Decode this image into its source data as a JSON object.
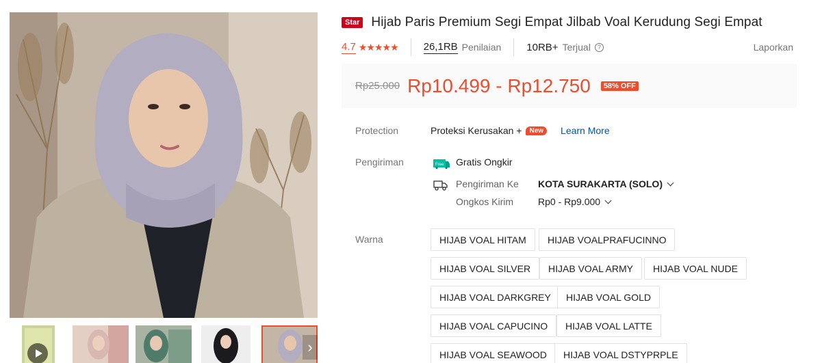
{
  "product": {
    "badge": "Star",
    "title": "Hijab Paris Premium Segi Empat Jilbab Voal Kerudung Segi Empat"
  },
  "rating": {
    "score": "4.7",
    "stars": "★★★★★",
    "reviews_count": "26,1RB",
    "reviews_label": "Penilaian",
    "sold_count": "10RB+",
    "sold_label": "Terjual",
    "report_label": "Laporkan"
  },
  "price": {
    "original": "Rp25.000",
    "current": "Rp10.499 - Rp12.750",
    "discount": "58% OFF"
  },
  "protection": {
    "label": "Protection",
    "value": "Proteksi Kerusakan +",
    "new_badge": "New",
    "learn_more": "Learn More"
  },
  "shipping": {
    "label": "Pengiriman",
    "free_icon_text": "Free",
    "free_shipping": "Gratis Ongkir",
    "destination_label": "Pengiriman Ke",
    "destination_value": "KOTA SURAKARTA (SOLO)",
    "cost_label": "Ongkos Kirim",
    "cost_value": "Rp0 - Rp9.000"
  },
  "variants": {
    "label": "Warna",
    "options": [
      "HIJAB VOAL HITAM",
      "HIJAB VOALPRAFUCINNO",
      "HIJAB VOAL SILVER",
      "HIJAB VOAL ARMY",
      "HIJAB VOAL NUDE",
      "HIJAB VOAL DARKGREY",
      "HIJAB VOAL GOLD",
      "HIJAB VOAL CAPUCINO",
      "HIJAB VOAL LATTE",
      "HIJAB VOAL SEAWOOD",
      "HIJAB VOAL DSTYPRPLE"
    ]
  },
  "colors": {
    "accent": "#ee4d2d",
    "star_badge": "#d0011b",
    "link": "#0055aa",
    "free_shipping_green": "#00bfa5"
  }
}
